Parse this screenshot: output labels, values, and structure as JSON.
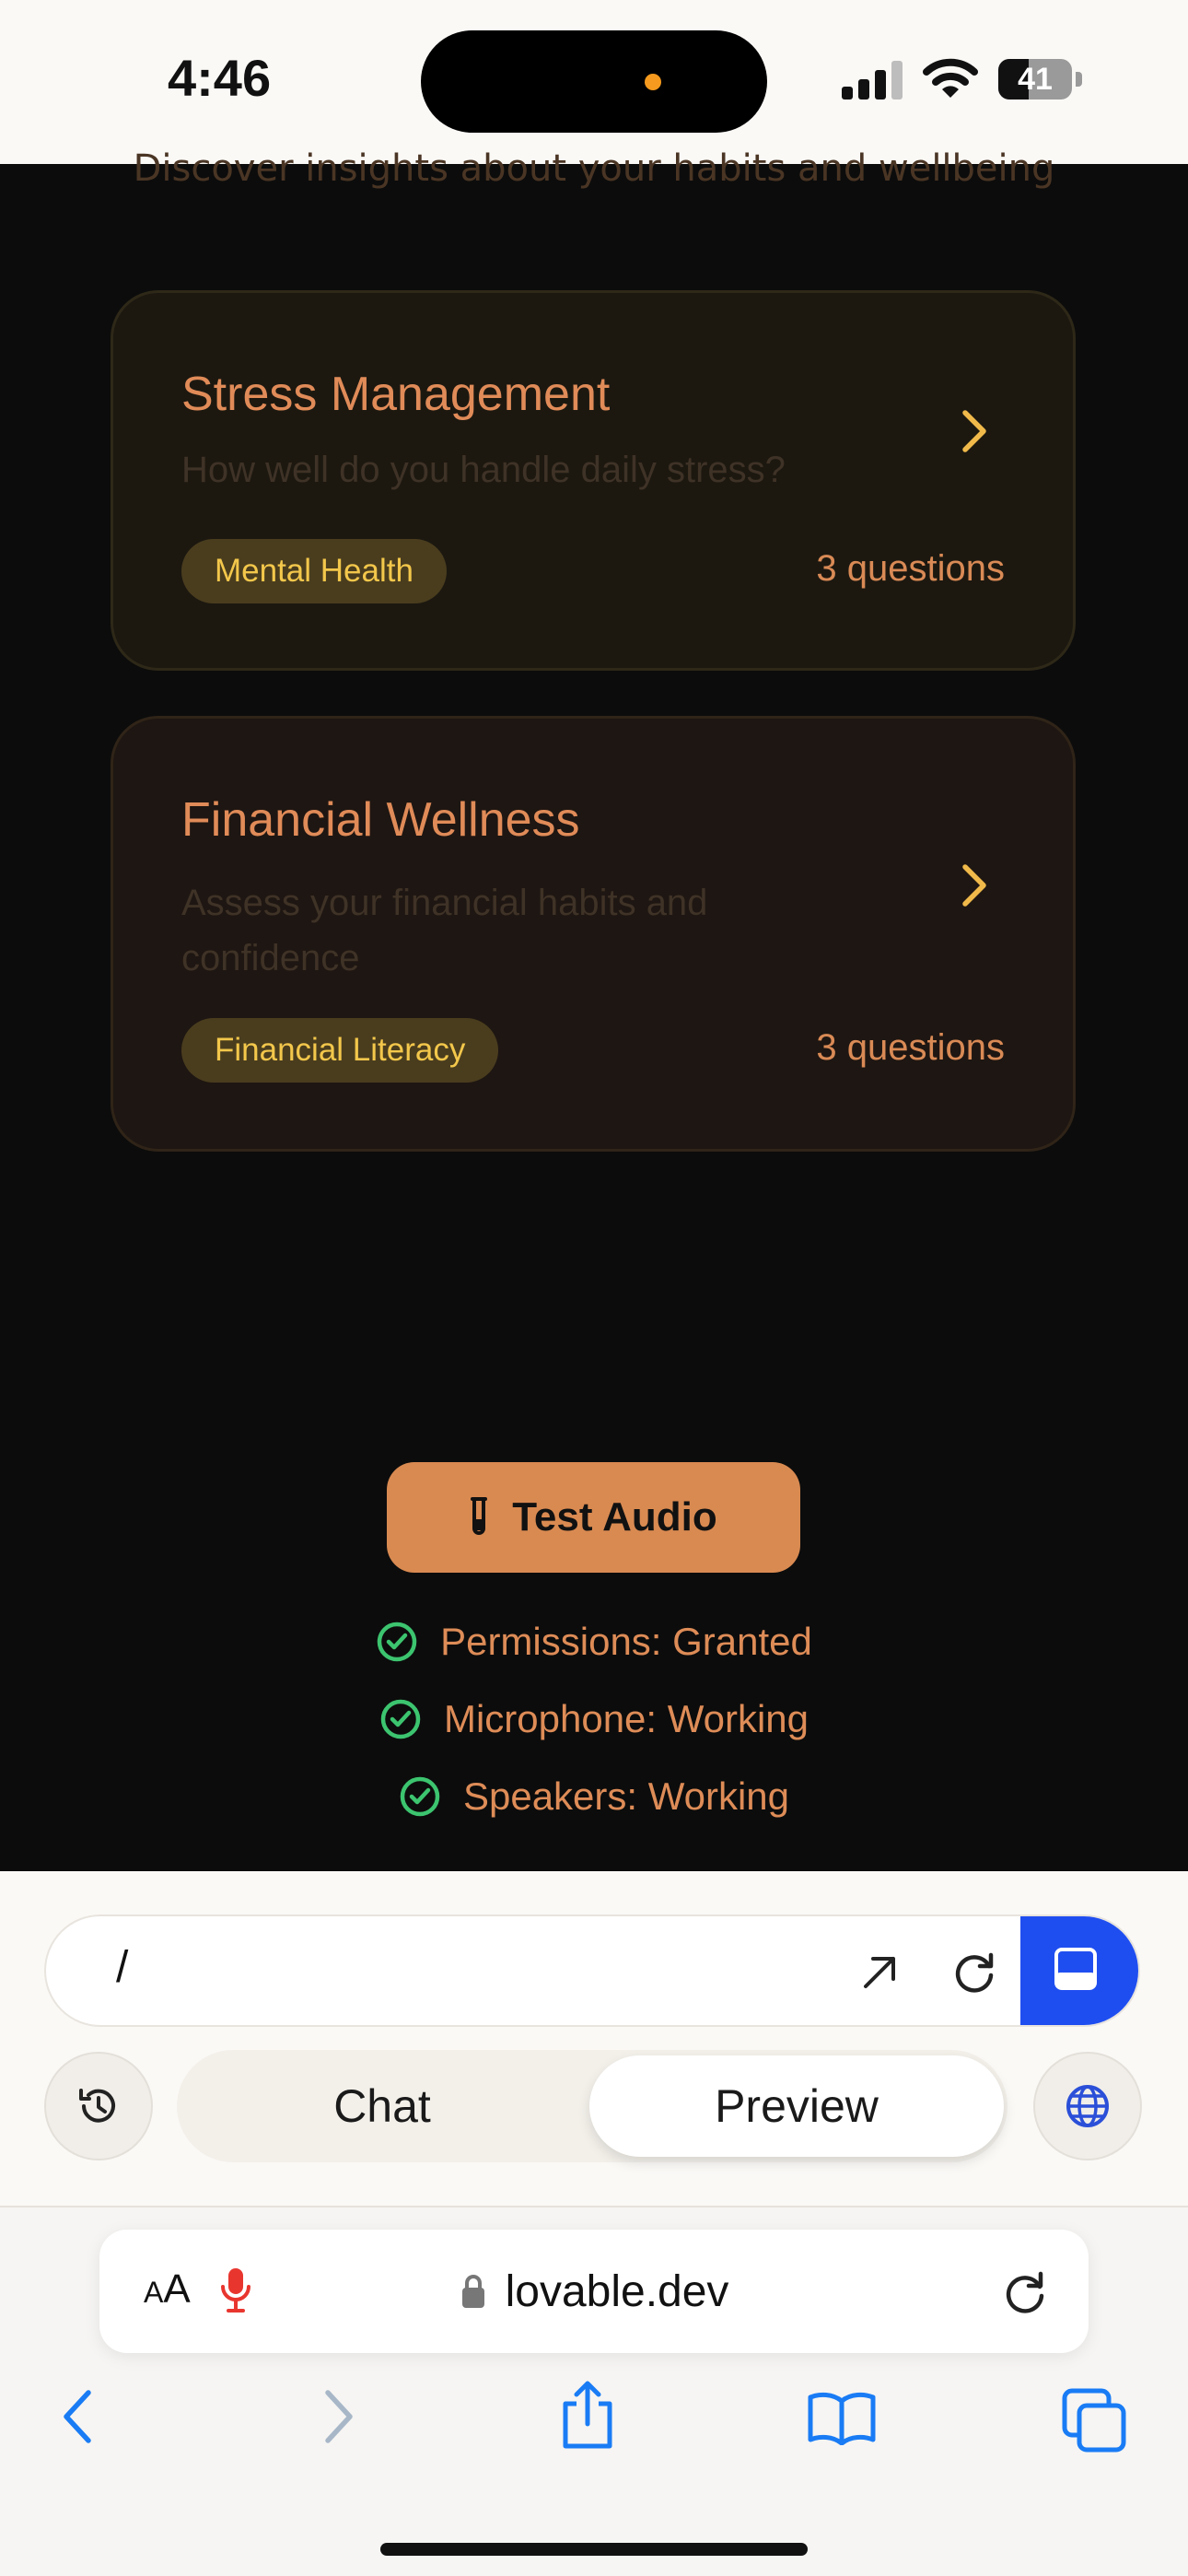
{
  "status_bar": {
    "time": "4:46",
    "battery": "41",
    "battery_level": 0.41
  },
  "page": {
    "subtitle": "Discover insights about your habits and wellbeing"
  },
  "quizzes": [
    {
      "title": "Stress Management",
      "description": "How well do you handle daily stress?",
      "tag": "Mental Health",
      "count": "3 questions"
    },
    {
      "title": "Financial Wellness",
      "description": "Assess your financial habits and confidence",
      "tag": "Financial Literacy",
      "count": "3 questions"
    }
  ],
  "audio": {
    "button_label": "Test Audio",
    "checks": [
      "Permissions: Granted",
      "Microphone: Working",
      "Speakers: Working"
    ]
  },
  "lovable": {
    "path": "/",
    "tabs": [
      "Chat",
      "Preview"
    ],
    "active_tab": "Preview"
  },
  "safari": {
    "aa_small": "A",
    "aa_large": "A",
    "url": "lovable.dev"
  },
  "colors": {
    "accent": "#d98a51",
    "tag_text": "#f3c74b",
    "check": "#3cc46f",
    "panel_blue": "#1f4ef0",
    "safari_blue": "#1a7cf5"
  },
  "icons": [
    "signal-icon",
    "wifi-icon",
    "battery-icon",
    "chevron-right-icon",
    "test-tube-icon",
    "check-circle-icon",
    "open-external-icon",
    "reload-icon",
    "panel-toggle-icon",
    "history-icon",
    "globe-icon",
    "microphone-icon",
    "lock-icon",
    "back-icon",
    "forward-icon",
    "share-icon",
    "bookmarks-icon",
    "tabs-icon"
  ]
}
